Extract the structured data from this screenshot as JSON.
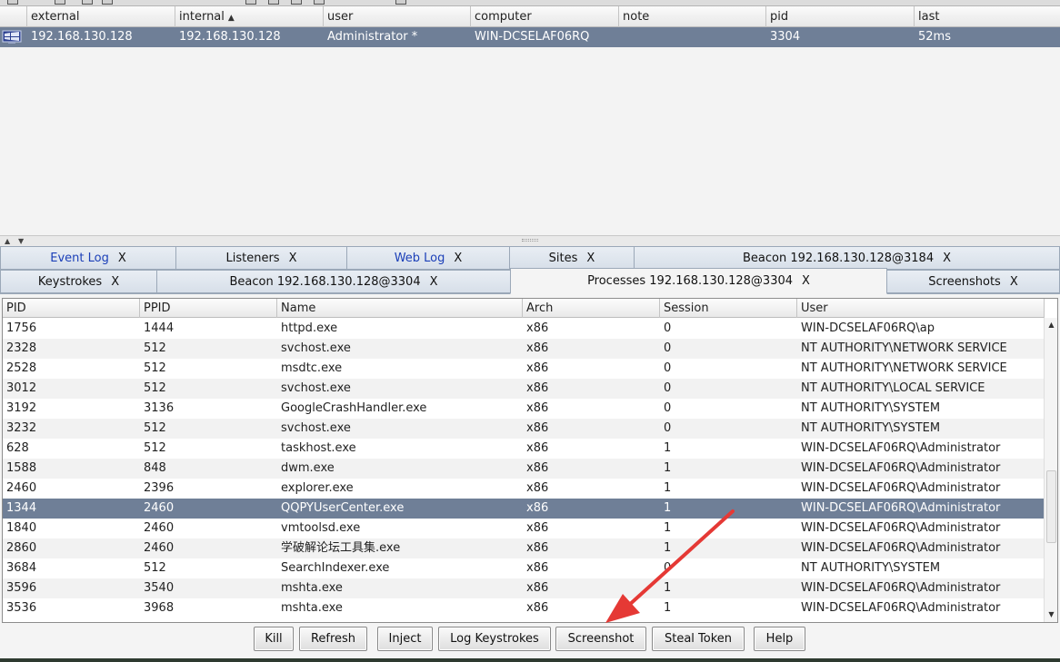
{
  "beacons": {
    "columns": [
      "external",
      "internal",
      "user",
      "computer",
      "note",
      "pid",
      "last"
    ],
    "sorted_column": "internal",
    "rows": [
      {
        "external": "192.168.130.128",
        "internal": "192.168.130.128",
        "user": "Administrator *",
        "computer": "WIN-DCSELAF06RQ",
        "note": "",
        "pid": "3304",
        "last": "52ms"
      }
    ]
  },
  "tabs_row1": [
    {
      "label": "Event Log",
      "close": "X",
      "blue": true
    },
    {
      "label": "Listeners",
      "close": "X"
    },
    {
      "label": "Web Log",
      "close": "X",
      "blue": true
    },
    {
      "label": "Sites",
      "close": "X"
    },
    {
      "label": "Beacon 192.168.130.128@3184",
      "close": "X"
    }
  ],
  "tabs_row2": [
    {
      "label": "Keystrokes",
      "close": "X"
    },
    {
      "label": "Beacon 192.168.130.128@3304",
      "close": "X"
    },
    {
      "label": "Processes 192.168.130.128@3304",
      "close": "X",
      "active": true
    },
    {
      "label": "Screenshots",
      "close": "X"
    }
  ],
  "processes": {
    "columns": [
      "PID",
      "PPID",
      "Name",
      "Arch",
      "Session",
      "User"
    ],
    "selected_pid": "1344",
    "rows": [
      [
        "1756",
        "1444",
        "httpd.exe",
        "x86",
        "0",
        "WIN-DCSELAF06RQ\\ap"
      ],
      [
        "2328",
        "512",
        "svchost.exe",
        "x86",
        "0",
        "NT AUTHORITY\\NETWORK SERVICE"
      ],
      [
        "2528",
        "512",
        "msdtc.exe",
        "x86",
        "0",
        "NT AUTHORITY\\NETWORK SERVICE"
      ],
      [
        "3012",
        "512",
        "svchost.exe",
        "x86",
        "0",
        "NT AUTHORITY\\LOCAL SERVICE"
      ],
      [
        "3192",
        "3136",
        "GoogleCrashHandler.exe",
        "x86",
        "0",
        "NT AUTHORITY\\SYSTEM"
      ],
      [
        "3232",
        "512",
        "svchost.exe",
        "x86",
        "0",
        "NT AUTHORITY\\SYSTEM"
      ],
      [
        "628",
        "512",
        "taskhost.exe",
        "x86",
        "1",
        "WIN-DCSELAF06RQ\\Administrator"
      ],
      [
        "1588",
        "848",
        "dwm.exe",
        "x86",
        "1",
        "WIN-DCSELAF06RQ\\Administrator"
      ],
      [
        "2460",
        "2396",
        "explorer.exe",
        "x86",
        "1",
        "WIN-DCSELAF06RQ\\Administrator"
      ],
      [
        "1344",
        "2460",
        "QQPYUserCenter.exe",
        "x86",
        "1",
        "WIN-DCSELAF06RQ\\Administrator"
      ],
      [
        "1840",
        "2460",
        "vmtoolsd.exe",
        "x86",
        "1",
        "WIN-DCSELAF06RQ\\Administrator"
      ],
      [
        "2860",
        "2460",
        "学破解论坛工具集.exe",
        "x86",
        "1",
        "WIN-DCSELAF06RQ\\Administrator"
      ],
      [
        "3684",
        "512",
        "SearchIndexer.exe",
        "x86",
        "0",
        "NT AUTHORITY\\SYSTEM"
      ],
      [
        "3596",
        "3540",
        "mshta.exe",
        "x86",
        "1",
        "WIN-DCSELAF06RQ\\Administrator"
      ],
      [
        "3536",
        "3968",
        "mshta.exe",
        "x86",
        "1",
        "WIN-DCSELAF06RQ\\Administrator"
      ]
    ]
  },
  "buttons": [
    "Kill",
    "Refresh",
    "Inject",
    "Log Keystrokes",
    "Screenshot",
    "Steal Token",
    "Help"
  ],
  "annotation": {
    "color": "#e53935",
    "points_to": "Screenshot"
  }
}
